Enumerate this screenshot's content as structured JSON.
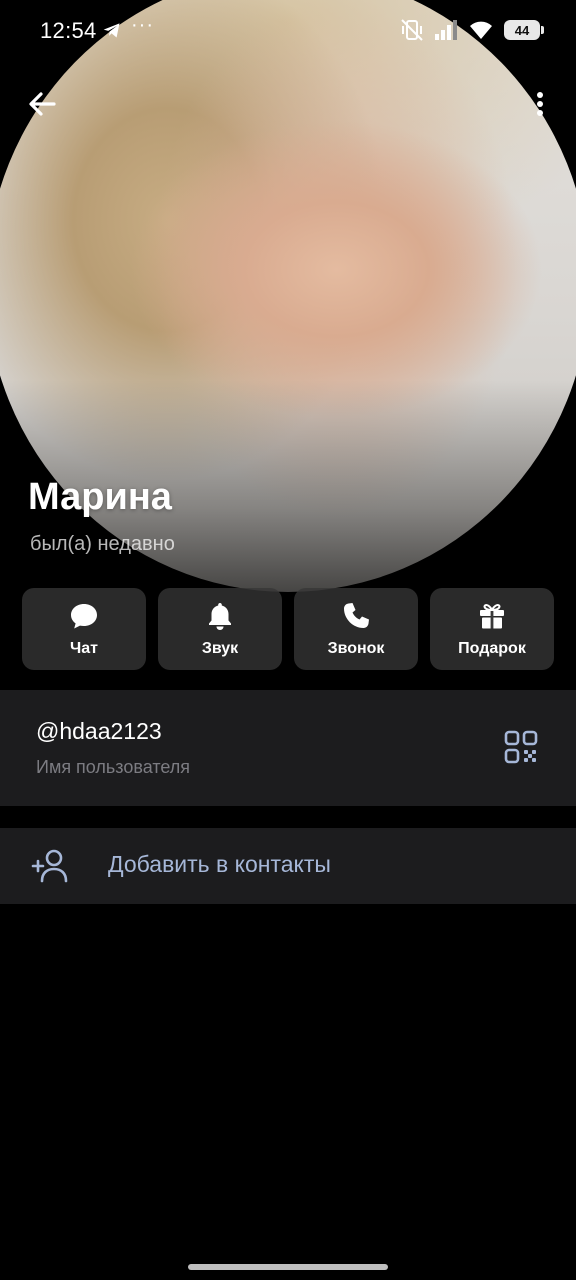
{
  "status_bar": {
    "time": "12:54",
    "more": "···",
    "battery": "44"
  },
  "profile": {
    "name": "Марина",
    "status": "был(а) недавно"
  },
  "actions": [
    {
      "label": "Чат",
      "icon": "chat-icon"
    },
    {
      "label": "Звук",
      "icon": "bell-icon"
    },
    {
      "label": "Звонок",
      "icon": "phone-icon"
    },
    {
      "label": "Подарок",
      "icon": "gift-icon"
    }
  ],
  "username": {
    "value": "@hdaa2123",
    "caption": "Имя пользователя"
  },
  "add_contact": {
    "label": "Добавить в контакты"
  },
  "colors": {
    "background": "#000000",
    "card": "#1c1c1e",
    "accent_text": "#a6b7d8",
    "secondary_text": "#7c7c82"
  }
}
